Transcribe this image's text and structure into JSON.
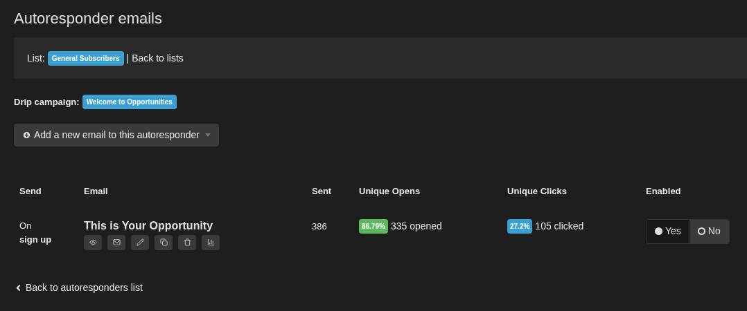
{
  "title": "Autoresponder emails",
  "list_bar": {
    "label": "List:",
    "list_badge": "General Subscribers",
    "separator": "|",
    "back_link": "Back to lists"
  },
  "drip_campaign": {
    "label": "Drip campaign:",
    "badge": "Welcome to Opportunities"
  },
  "add_button": {
    "label": "Add a new email to this autoresponder"
  },
  "table": {
    "columns": [
      "Send",
      "Email",
      "Sent",
      "Unique Opens",
      "Unique Clicks",
      "Enabled"
    ],
    "rows": [
      {
        "send_prefix": "On",
        "send_event": "sign up",
        "email": "This is Your Opportunity",
        "sent": "386",
        "opens_badge": "86.79%",
        "opens_text": "335 opened",
        "clicks_badge": "27.2%",
        "clicks_text": "105 clicked",
        "enabled_options": [
          {
            "label": "Yes",
            "selected": true
          },
          {
            "label": "No",
            "selected": false
          }
        ]
      }
    ]
  },
  "back_link": "Back to autoresponders list"
}
